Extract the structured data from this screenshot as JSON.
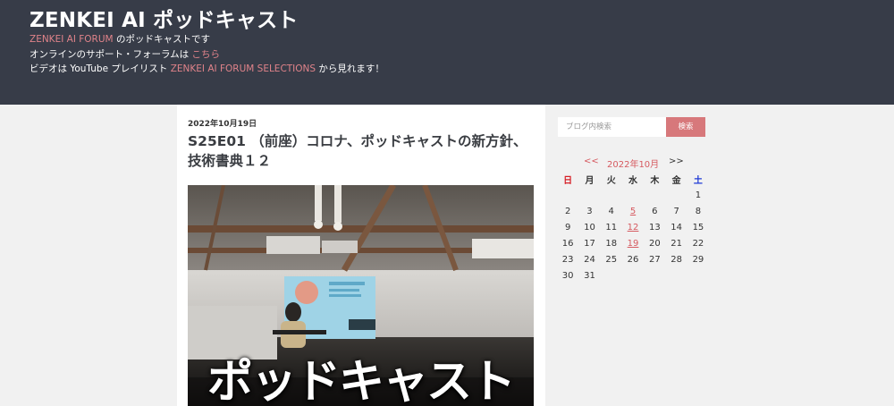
{
  "header": {
    "title": "ZENKEI AI ポッドキャスト",
    "line1_link": "ZENKEI AI FORUM",
    "line1_text": " のポッドキャストです",
    "line2_text": "オンラインのサポート・フォーラムは ",
    "line2_link": "こちら",
    "line3_pre": "ビデオは YouTube プレイリスト ",
    "line3_link": "ZENKEI AI FORUM SELECTIONS",
    "line3_post": " から見れます！"
  },
  "post": {
    "date": "2022年10月19日",
    "title": "S25E01 （前座）コロナ、ポッドキャストの新方針、技術書典１２",
    "image_text": "ポッドキャスト"
  },
  "sidebar": {
    "search_placeholder": "ブログ内検索",
    "search_button": "検索",
    "calendar": {
      "prev": "<<",
      "month": "2022年10月",
      "next": ">>",
      "weekdays": [
        "日",
        "月",
        "火",
        "水",
        "木",
        "金",
        "土"
      ],
      "weeks": [
        [
          "",
          "",
          "",
          "",
          "",
          "",
          "1"
        ],
        [
          "2",
          "3",
          "4",
          "5",
          "6",
          "7",
          "8"
        ],
        [
          "9",
          "10",
          "11",
          "12",
          "13",
          "14",
          "15"
        ],
        [
          "16",
          "17",
          "18",
          "19",
          "20",
          "21",
          "22"
        ],
        [
          "23",
          "24",
          "25",
          "26",
          "27",
          "28",
          "29"
        ],
        [
          "30",
          "31",
          "",
          "",
          "",
          "",
          ""
        ]
      ],
      "linked_days": [
        "5",
        "12",
        "19"
      ]
    }
  },
  "colors": {
    "header_bg": "#373c48",
    "accent": "#d7787b",
    "link": "#e0838a",
    "sunday": "#d61f26",
    "saturday": "#1f3ad6"
  }
}
